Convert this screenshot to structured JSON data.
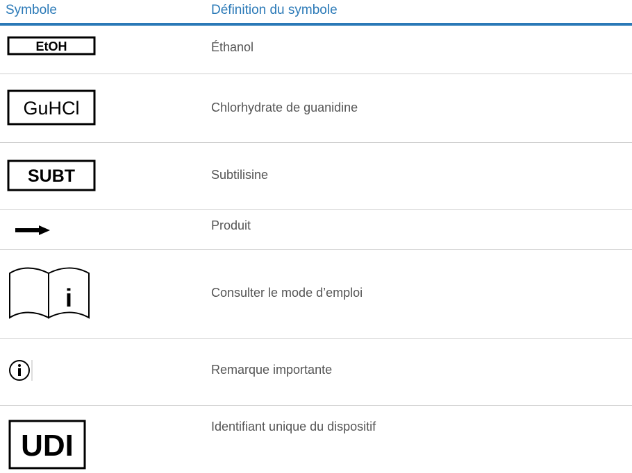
{
  "header": {
    "symbol_col": "Symbole",
    "definition_col": "Définition du symbole"
  },
  "rows": [
    {
      "symbol": "EtOH",
      "icon": "ethanol-label-icon",
      "definition": "Éthanol"
    },
    {
      "symbol": "GuHCl",
      "icon": "guanidine-label-icon",
      "definition": "Chlorhydrate de guanidine"
    },
    {
      "symbol": "SUBT",
      "icon": "subtilisin-label-icon",
      "definition": "Subtilisine"
    },
    {
      "symbol": "",
      "icon": "arrow-right-icon",
      "definition": "Produit"
    },
    {
      "symbol": "i",
      "icon": "instructions-book-icon",
      "definition": "Consulter le mode d’emploi"
    },
    {
      "symbol": "",
      "icon": "info-circle-icon",
      "definition": "Remarque importante"
    },
    {
      "symbol": "UDI",
      "icon": "udi-label-icon",
      "definition": "Identifiant unique du dispositif"
    }
  ],
  "colors": {
    "accent": "#2a79b7",
    "rule": "#cfcfcf",
    "text": "#545454"
  }
}
